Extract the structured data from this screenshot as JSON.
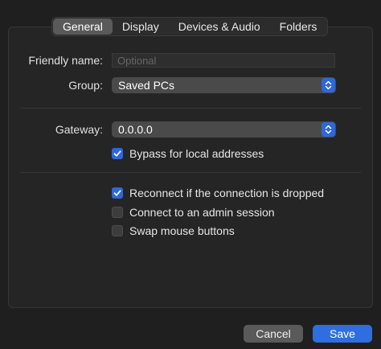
{
  "tabs": [
    {
      "label": "General",
      "active": true
    },
    {
      "label": "Display",
      "active": false
    },
    {
      "label": "Devices & Audio",
      "active": false
    },
    {
      "label": "Folders",
      "active": false
    }
  ],
  "form": {
    "friendly_name_label": "Friendly name:",
    "friendly_name_placeholder": "Optional",
    "friendly_name_value": "",
    "group_label": "Group:",
    "group_value": "Saved PCs",
    "gateway_label": "Gateway:",
    "gateway_value": "0.0.0.0",
    "bypass_label": "Bypass for local addresses",
    "bypass_checked": true
  },
  "options": [
    {
      "label": "Reconnect if the connection is dropped",
      "checked": true
    },
    {
      "label": "Connect to an admin session",
      "checked": false
    },
    {
      "label": "Swap mouse buttons",
      "checked": false
    }
  ],
  "footer": {
    "cancel_label": "Cancel",
    "save_label": "Save"
  },
  "colors": {
    "accent": "#2f67d8",
    "background": "#1f1f1f",
    "panel": "#252525"
  }
}
